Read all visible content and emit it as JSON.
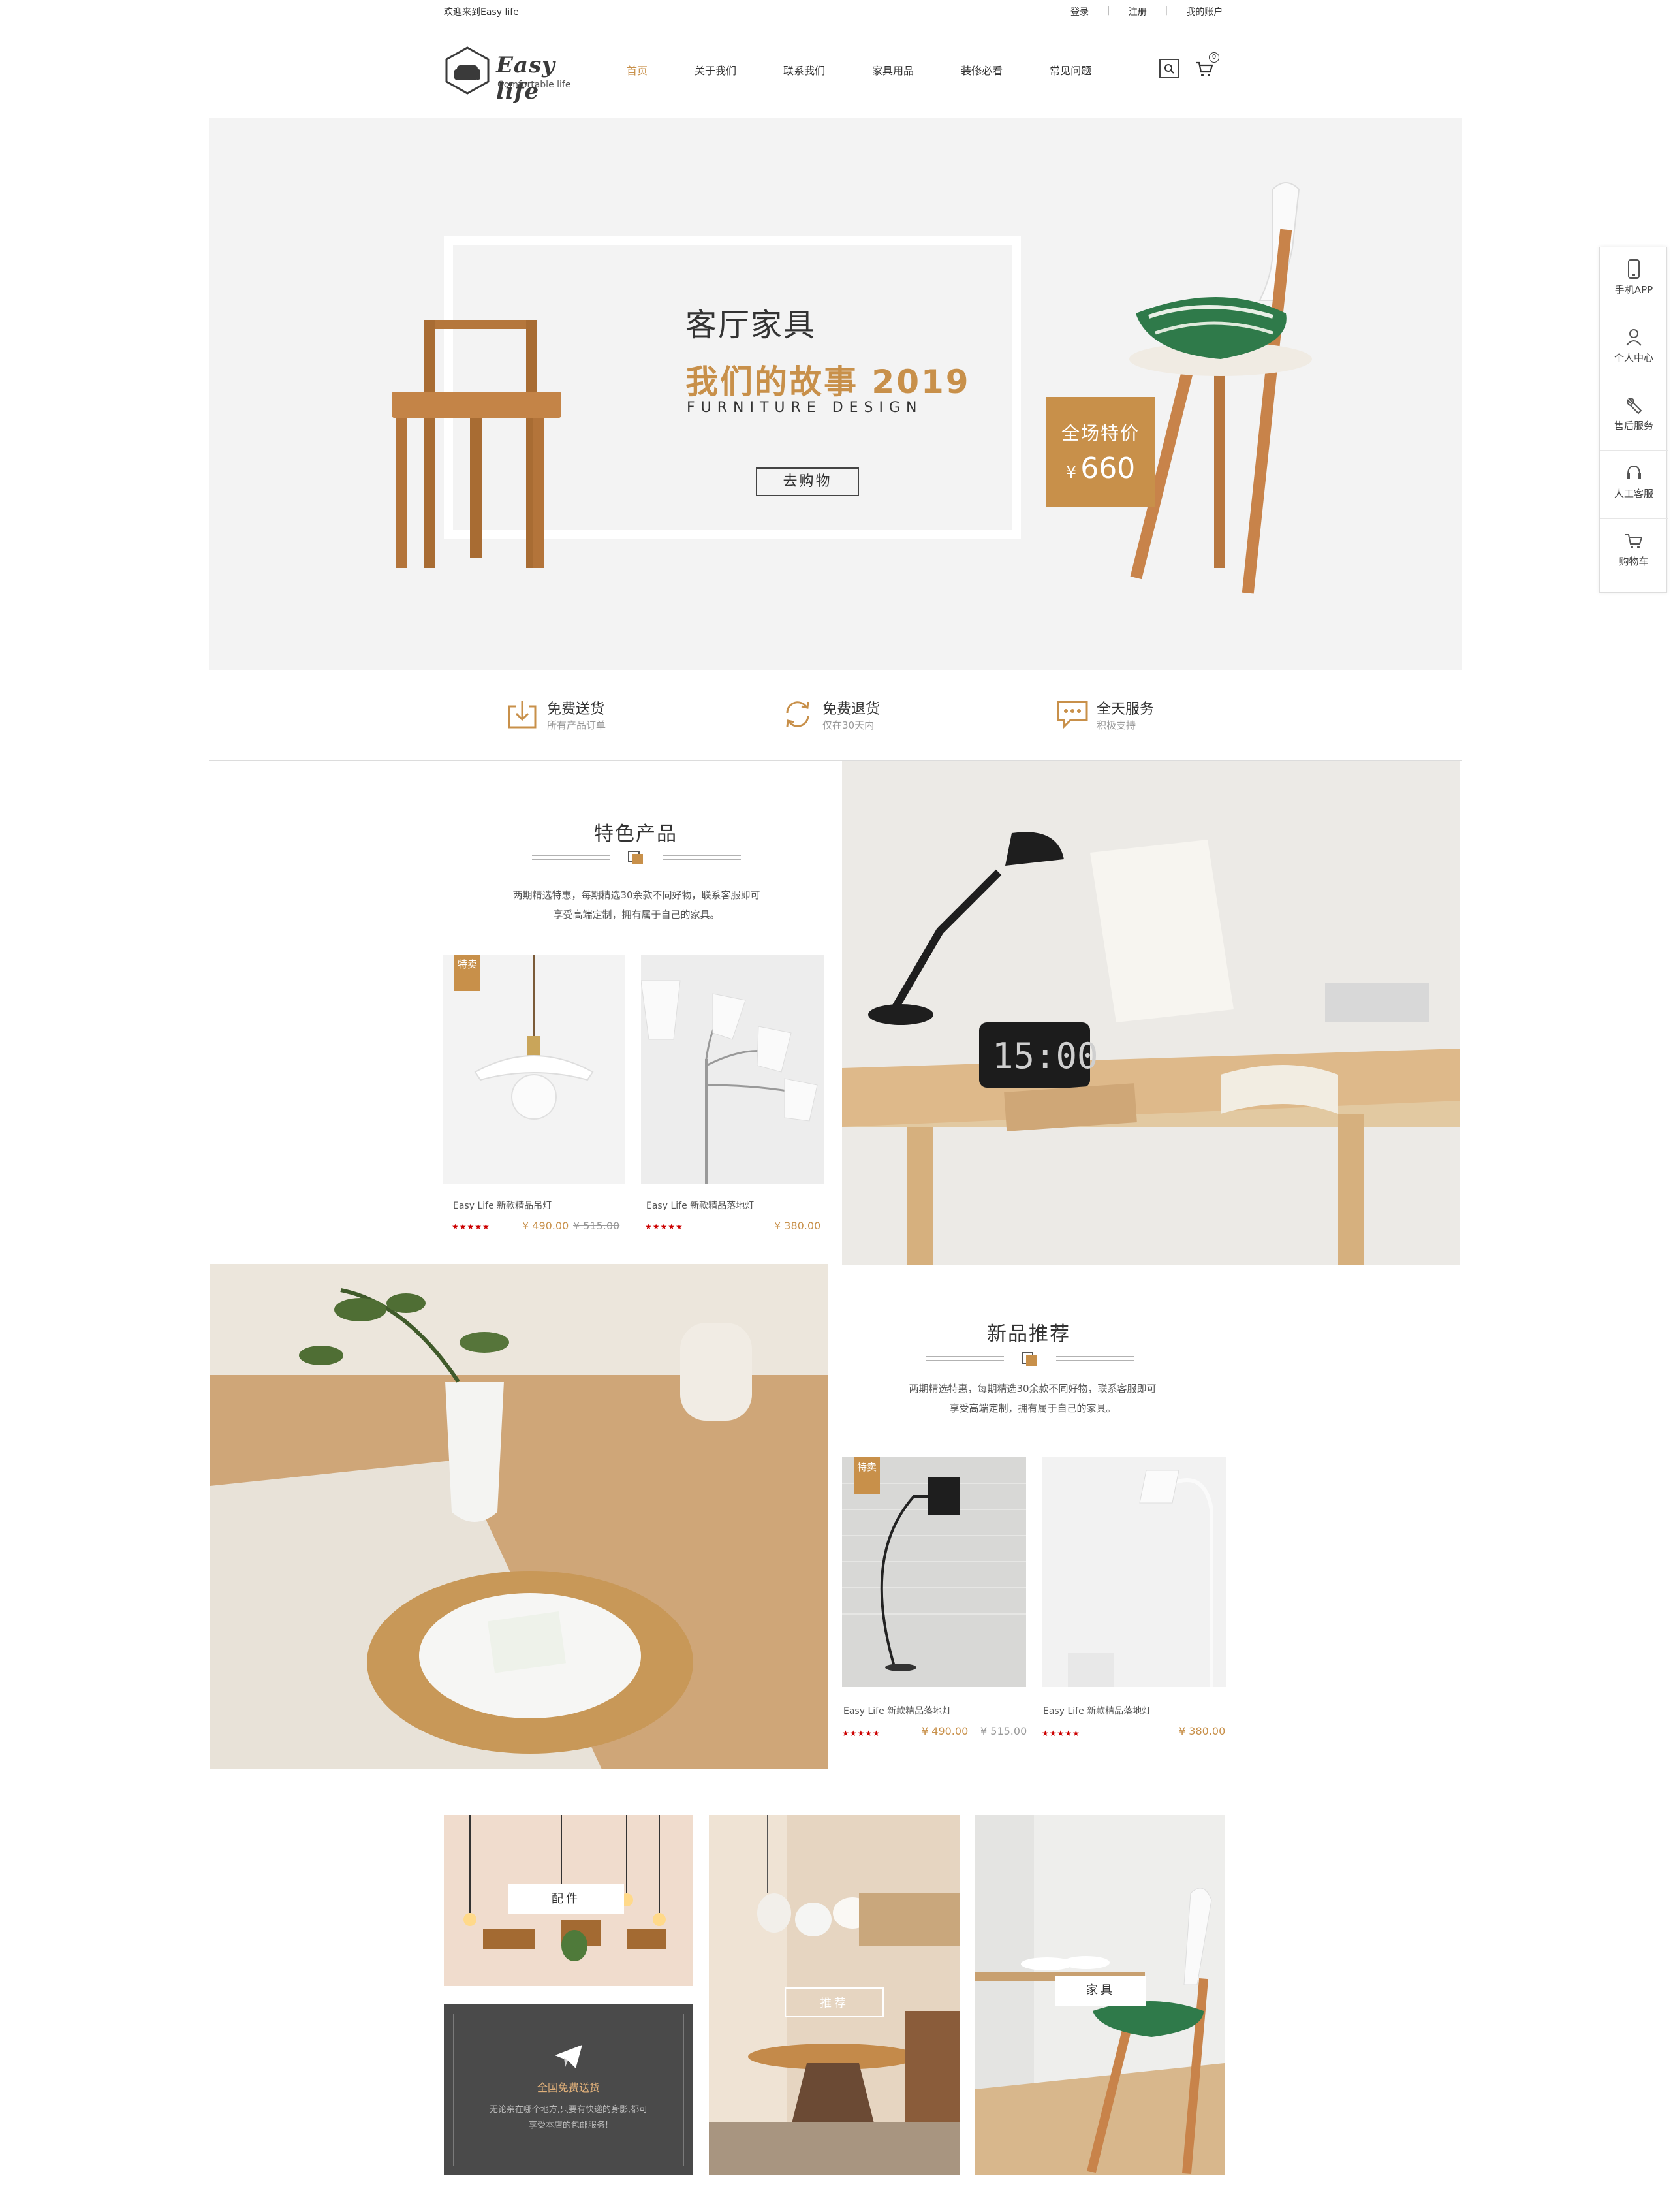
{
  "topbar": {
    "welcome": "欢迎来到Easy life",
    "login": "登录",
    "register": "注册",
    "account": "我的账户"
  },
  "logo": {
    "title": "Easy life",
    "subtitle": "Comfortable life"
  },
  "nav": {
    "items": [
      "首页",
      "关于我们",
      "联系我们",
      "家具用品",
      "装修必看",
      "常见问题"
    ],
    "active_index": 0
  },
  "header": {
    "search_icon": "search-icon",
    "cart_icon": "cart-icon",
    "cart_count": "0"
  },
  "hero": {
    "title": "客厅家具",
    "headline": "我们的故事 2019",
    "subtitle": "FURNITURE DESIGN",
    "button": "去购物",
    "promo_label": "全场特价",
    "promo_currency": "¥",
    "promo_price": "660"
  },
  "sidebar": {
    "items": [
      {
        "label": "手机APP",
        "icon": "phone-icon"
      },
      {
        "label": "个人中心",
        "icon": "user-icon"
      },
      {
        "label": "售后服务",
        "icon": "wrench-icon"
      },
      {
        "label": "人工客服",
        "icon": "headset-icon"
      },
      {
        "label": "购物车",
        "icon": "cart-icon"
      }
    ]
  },
  "features": [
    {
      "title": "免费送货",
      "desc": "所有产品订单",
      "icon": "download-box-icon"
    },
    {
      "title": "免费退货",
      "desc": "仅在30天内",
      "icon": "refresh-icon"
    },
    {
      "title": "全天服务",
      "desc": "积极支持",
      "icon": "chat-icon"
    }
  ],
  "featured": {
    "title": "特色产品",
    "desc_line1": "两期精选特惠，每期精选30余款不同好物，联系客服即可",
    "desc_line2": "享受高端定制，拥有属于自己的家具。",
    "products": [
      {
        "tag": "特卖",
        "name": "Easy Life 新款精品吊灯",
        "stars": "★★★★★",
        "price": "¥ 490.00",
        "old_price": "¥ 515.00"
      },
      {
        "tag": "",
        "name": "Easy Life 新款精品落地灯",
        "stars": "★★★★★",
        "price": "¥ 380.00",
        "old_price": ""
      }
    ]
  },
  "newarrivals": {
    "title": "新品推荐",
    "desc_line1": "两期精选特惠，每期精选30余款不同好物，联系客服即可",
    "desc_line2": "享受高端定制，拥有属于自己的家具。",
    "products": [
      {
        "tag": "特卖",
        "name": "Easy Life 新款精品落地灯",
        "stars": "★★★★★",
        "price": "¥ 490.00",
        "old_price": "¥ 515.00"
      },
      {
        "tag": "",
        "name": "Easy Life 新款精品落地灯",
        "stars": "★★★★★",
        "price": "¥ 380.00",
        "old_price": ""
      }
    ]
  },
  "grid": {
    "accessories": "配件",
    "recommend": "推荐",
    "furniture": "家具",
    "shipping_title": "全国免费送货",
    "shipping_desc1": "无论亲在哪个地方,只要有快递的身影,都可",
    "shipping_desc2": "享受本店的包邮服务!"
  },
  "colors": {
    "accent": "#c8904a",
    "dark_tile": "#4a4a4a",
    "hero_bg": "#f3f3f3",
    "star": "#cc0000"
  }
}
